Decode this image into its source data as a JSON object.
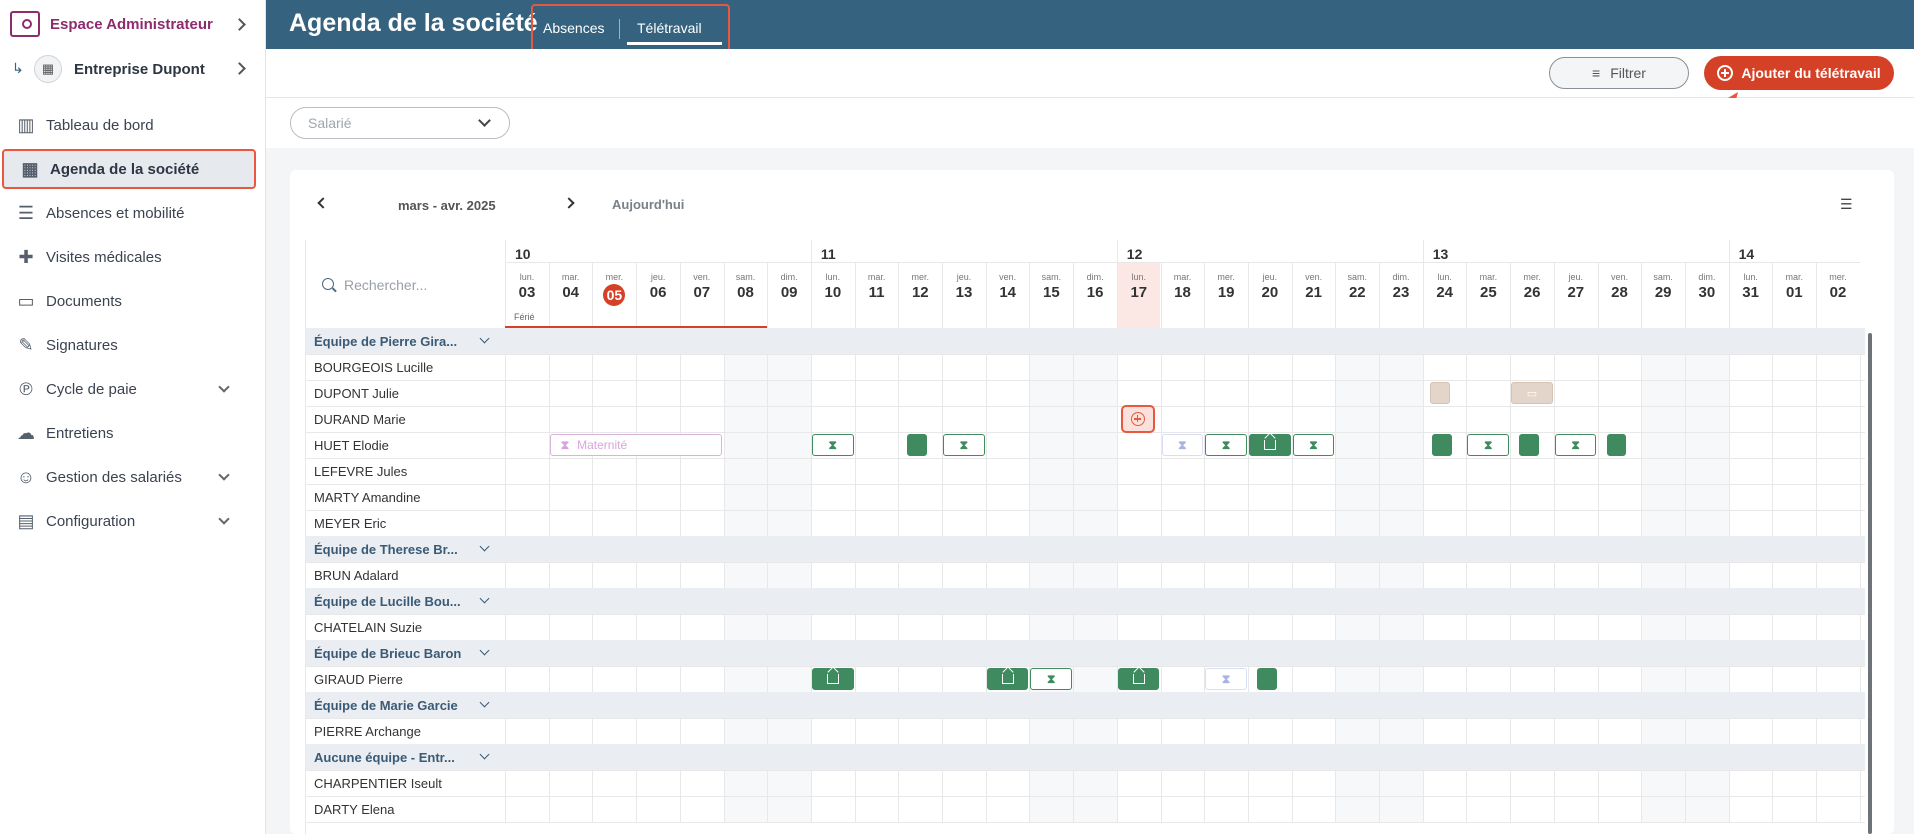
{
  "sidebar": {
    "admin_space": "Espace Administrateur",
    "company": "Entreprise Dupont",
    "items": [
      {
        "label": "Tableau de bord",
        "icon": "dashboard-icon",
        "expandable": false
      },
      {
        "label": "Agenda de la société",
        "icon": "calendar-icon",
        "expandable": false,
        "active": true
      },
      {
        "label": "Absences et mobilité",
        "icon": "list-icon",
        "expandable": false
      },
      {
        "label": "Visites médicales",
        "icon": "medical-cross-icon",
        "expandable": false
      },
      {
        "label": "Documents",
        "icon": "folder-icon",
        "expandable": false
      },
      {
        "label": "Signatures",
        "icon": "pen-icon",
        "expandable": false
      },
      {
        "label": "Cycle de paie",
        "icon": "payroll-icon",
        "expandable": true
      },
      {
        "label": "Entretiens",
        "icon": "chat-icon",
        "expandable": false
      },
      {
        "label": "Gestion des salariés",
        "icon": "people-icon",
        "expandable": true
      },
      {
        "label": "Configuration",
        "icon": "settings-icon",
        "expandable": true
      }
    ]
  },
  "header": {
    "title": "Agenda de la société",
    "tabs": [
      {
        "label": "Absences"
      },
      {
        "label": "Télétravail",
        "active": true
      }
    ]
  },
  "toolbar": {
    "filter_label": "Filtrer",
    "add_label": "Ajouter du télétravail"
  },
  "filters": {
    "employee_placeholder": "Salarié"
  },
  "calendar": {
    "period": "mars - avr. 2025",
    "today_label": "Aujourd'hui",
    "search_placeholder": "Rechercher...",
    "holiday_label": "Férié",
    "weeks": [
      "10",
      "11",
      "12",
      "13",
      "14"
    ],
    "days": [
      {
        "dow": "lun.",
        "num": "03"
      },
      {
        "dow": "mar.",
        "num": "04"
      },
      {
        "dow": "mer.",
        "num": "05",
        "today": true
      },
      {
        "dow": "jeu.",
        "num": "06"
      },
      {
        "dow": "ven.",
        "num": "07"
      },
      {
        "dow": "sam.",
        "num": "08"
      },
      {
        "dow": "dim.",
        "num": "09"
      },
      {
        "dow": "lun.",
        "num": "10"
      },
      {
        "dow": "mar.",
        "num": "11"
      },
      {
        "dow": "mer.",
        "num": "12"
      },
      {
        "dow": "jeu.",
        "num": "13"
      },
      {
        "dow": "ven.",
        "num": "14"
      },
      {
        "dow": "sam.",
        "num": "15"
      },
      {
        "dow": "dim.",
        "num": "16"
      },
      {
        "dow": "lun.",
        "num": "17",
        "highlight": true
      },
      {
        "dow": "mar.",
        "num": "18"
      },
      {
        "dow": "mer.",
        "num": "19"
      },
      {
        "dow": "jeu.",
        "num": "20"
      },
      {
        "dow": "ven.",
        "num": "21"
      },
      {
        "dow": "sam.",
        "num": "22"
      },
      {
        "dow": "dim.",
        "num": "23"
      },
      {
        "dow": "lun.",
        "num": "24"
      },
      {
        "dow": "mar.",
        "num": "25"
      },
      {
        "dow": "mer.",
        "num": "26"
      },
      {
        "dow": "jeu.",
        "num": "27"
      },
      {
        "dow": "ven.",
        "num": "28"
      },
      {
        "dow": "sam.",
        "num": "29"
      },
      {
        "dow": "dim.",
        "num": "30"
      },
      {
        "dow": "lun.",
        "num": "31"
      },
      {
        "dow": "mar.",
        "num": "01"
      },
      {
        "dow": "mer.",
        "num": "02"
      }
    ],
    "rows": [
      {
        "type": "team",
        "label": "Équipe de Pierre Gira..."
      },
      {
        "type": "emp",
        "label": "BOURGEOIS Lucille"
      },
      {
        "type": "emp",
        "label": "DUPONT Julie"
      },
      {
        "type": "emp",
        "label": "DURAND Marie"
      },
      {
        "type": "emp",
        "label": "HUET Elodie"
      },
      {
        "type": "emp",
        "label": "LEFEVRE Jules"
      },
      {
        "type": "emp",
        "label": "MARTY Amandine"
      },
      {
        "type": "emp",
        "label": "MEYER Eric"
      },
      {
        "type": "team",
        "label": "Équipe de Therese Br..."
      },
      {
        "type": "emp",
        "label": "BRUN Adalard"
      },
      {
        "type": "team",
        "label": "Équipe de Lucille Bou..."
      },
      {
        "type": "emp",
        "label": "CHATELAIN Suzie"
      },
      {
        "type": "team",
        "label": "Équipe de Brieuc Baron"
      },
      {
        "type": "emp",
        "label": "GIRAUD Pierre"
      },
      {
        "type": "team",
        "label": "Équipe de Marie Garcie"
      },
      {
        "type": "emp",
        "label": "PIERRE Archange"
      },
      {
        "type": "team",
        "label": "Aucune équipe - Entr..."
      },
      {
        "type": "emp",
        "label": "CHARPENTIER Iseult"
      },
      {
        "type": "emp",
        "label": "DARTY Elena"
      }
    ],
    "events": [
      {
        "row": 2,
        "start": 21,
        "span": 1,
        "style": "tan",
        "kind": "half"
      },
      {
        "row": 2,
        "start": 23,
        "span": 1,
        "style": "tan",
        "kind": "folder"
      },
      {
        "row": 4,
        "start": 1,
        "span": 4,
        "style": "pink",
        "kind": "hourglass",
        "label": "Maternité"
      },
      {
        "row": 4,
        "start": 7,
        "span": 1,
        "style": "outline",
        "kind": "hourglass"
      },
      {
        "row": 4,
        "start": 9,
        "span": 1,
        "style": "green",
        "kind": "half"
      },
      {
        "row": 4,
        "start": 10,
        "span": 1,
        "style": "outline",
        "kind": "hourglass"
      },
      {
        "row": 4,
        "start": 15,
        "span": 1,
        "style": "faint",
        "kind": "hourglass"
      },
      {
        "row": 4,
        "start": 16,
        "span": 1,
        "style": "outline",
        "kind": "hourglass"
      },
      {
        "row": 4,
        "start": 17,
        "span": 1,
        "style": "green",
        "kind": "home"
      },
      {
        "row": 4,
        "start": 18,
        "span": 1,
        "style": "outline",
        "kind": "hourglass"
      },
      {
        "row": 4,
        "start": 21,
        "span": 1,
        "style": "green",
        "kind": "half"
      },
      {
        "row": 4,
        "start": 22,
        "span": 1,
        "style": "outline",
        "kind": "hourglass"
      },
      {
        "row": 4,
        "start": 23,
        "span": 1,
        "style": "green",
        "kind": "half"
      },
      {
        "row": 4,
        "start": 24,
        "span": 1,
        "style": "outline",
        "kind": "hourglass"
      },
      {
        "row": 4,
        "start": 25,
        "span": 1,
        "style": "green",
        "kind": "half"
      },
      {
        "row": 13,
        "start": 7,
        "span": 1,
        "style": "green",
        "kind": "home"
      },
      {
        "row": 13,
        "start": 11,
        "span": 1,
        "style": "green",
        "kind": "home"
      },
      {
        "row": 13,
        "start": 12,
        "span": 1,
        "style": "outline",
        "kind": "hourglass"
      },
      {
        "row": 13,
        "start": 14,
        "span": 1,
        "style": "green",
        "kind": "home"
      },
      {
        "row": 13,
        "start": 16,
        "span": 1,
        "style": "faint",
        "kind": "hourglass"
      },
      {
        "row": 13,
        "start": 17,
        "span": 1,
        "style": "green",
        "kind": "half"
      }
    ],
    "add_marker": {
      "row": 3,
      "day": 14
    }
  },
  "colors": {
    "header": "#35627e",
    "accent": "#d44127",
    "telework": "#3f8a5f",
    "team_row": "#eaeef2"
  }
}
